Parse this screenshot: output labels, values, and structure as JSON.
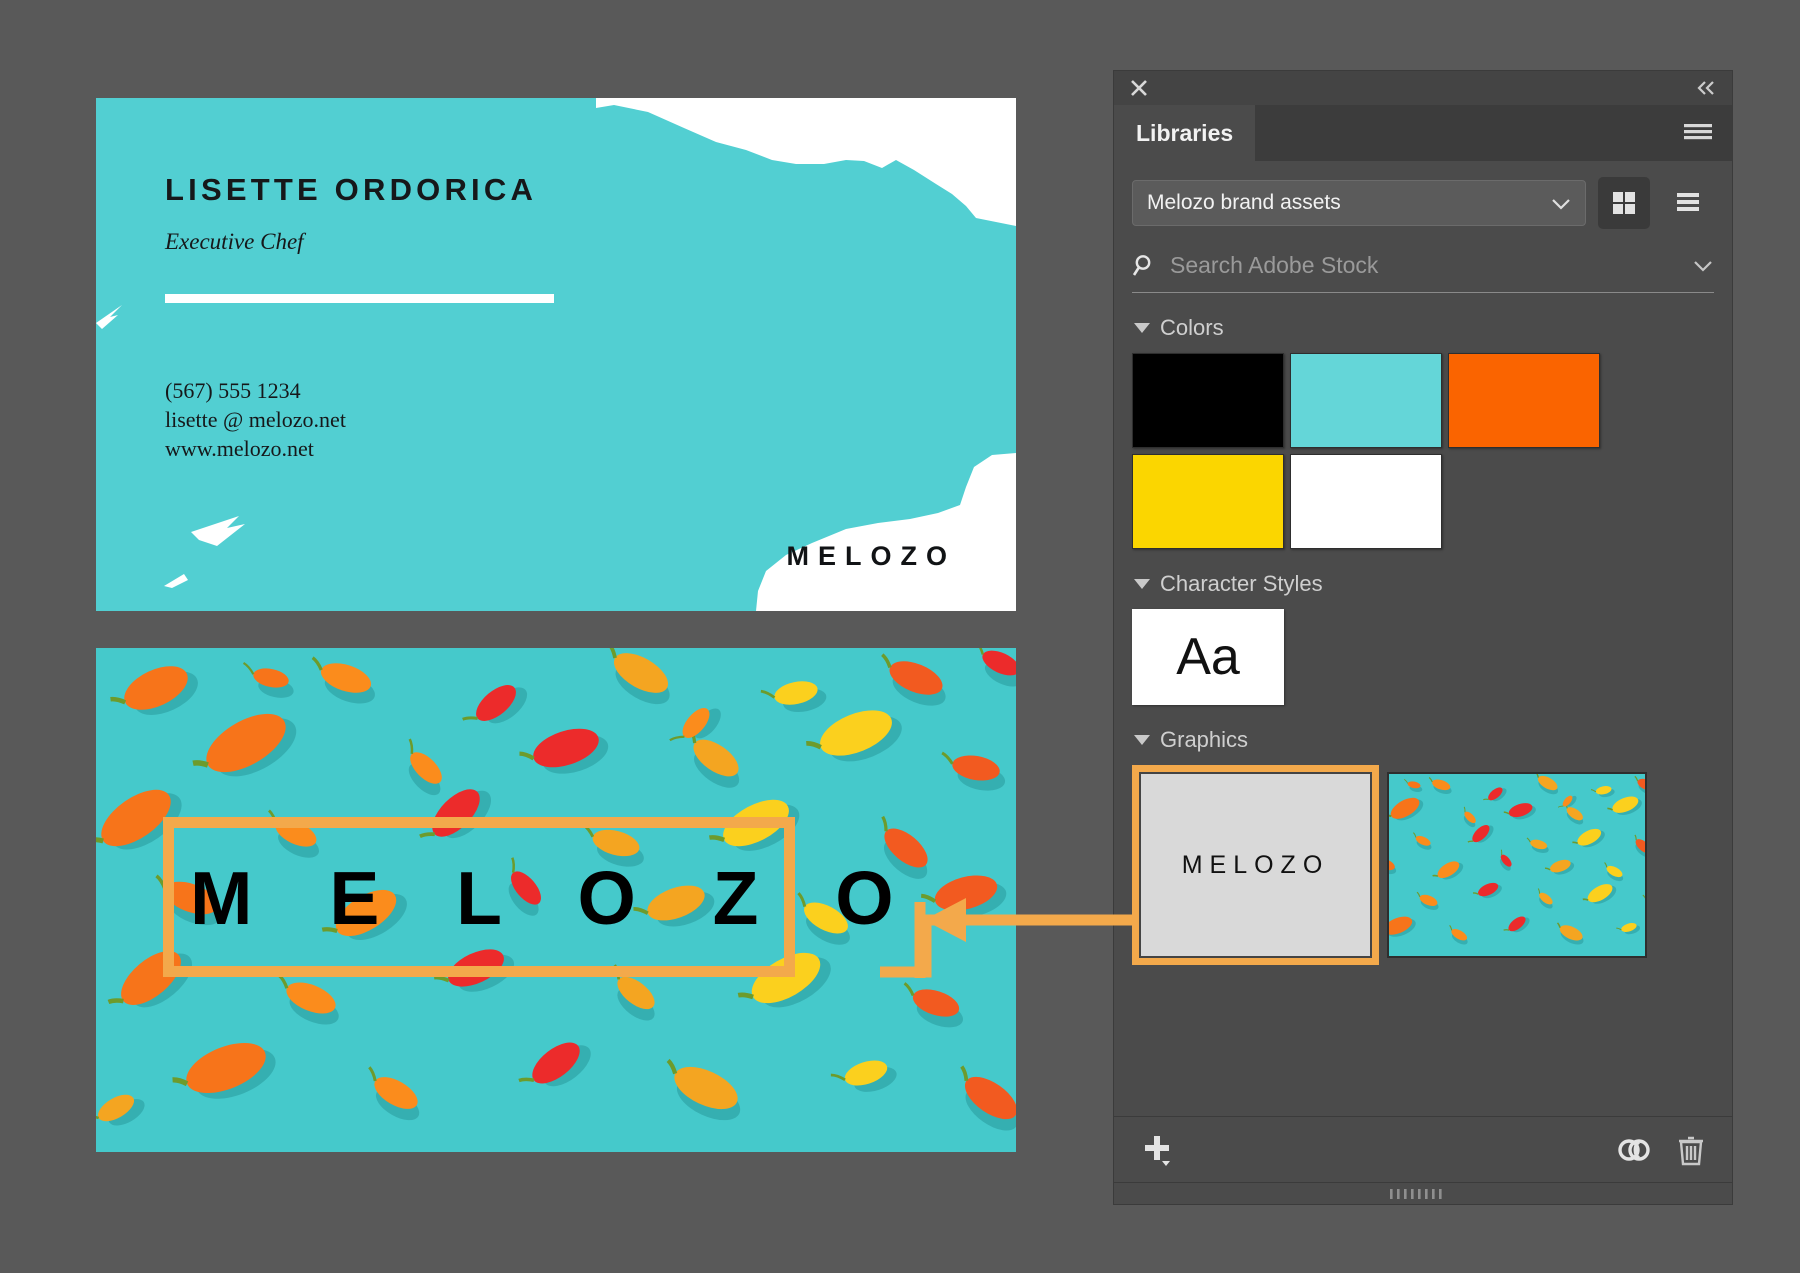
{
  "app": {
    "backdrop_color": "#595959"
  },
  "business_card": {
    "name": "LISETTE ORDORICA",
    "role": "Executive Chef",
    "phone": "(567) 555 1234",
    "email": "lisette @ melozo.net",
    "website": "www.melozo.net",
    "logo": "MELOZO",
    "background_color": "#52cfd2",
    "text_color": "#16181a"
  },
  "banner": {
    "word": "M E L O Z O",
    "background_color": "#45c9cb",
    "highlight_color": "#f3a94b",
    "word_color": "#000000"
  },
  "panel": {
    "close_icon": "close-icon",
    "collapse_icon": "collapse-double-chevron-icon",
    "menu_icon": "hamburger-menu-icon",
    "tab_label": "Libraries",
    "library_select": {
      "value": "Melozo brand assets",
      "chevron_icon": "chevron-down-icon"
    },
    "view_grid_icon": "grid-view-icon",
    "view_list_icon": "list-view-icon",
    "search": {
      "icon": "search-icon",
      "placeholder": "Search Adobe Stock",
      "value": "",
      "chevron_icon": "chevron-down-icon"
    },
    "sections": {
      "colors": {
        "label": "Colors",
        "expanded": true,
        "swatches": [
          {
            "name": "black",
            "hex": "#000000"
          },
          {
            "name": "turquoise",
            "hex": "#64d6d8"
          },
          {
            "name": "orange",
            "hex": "#fa6400"
          },
          {
            "name": "yellow",
            "hex": "#fbd600"
          },
          {
            "name": "white",
            "hex": "#ffffff"
          }
        ]
      },
      "character_styles": {
        "label": "Character Styles",
        "expanded": true,
        "items": [
          {
            "name": "type-sample",
            "sample": "Aa"
          }
        ]
      },
      "graphics": {
        "label": "Graphics",
        "expanded": true,
        "items": [
          {
            "name": "melozo-logo-graphic",
            "caption": "MELOZO",
            "selected": true
          },
          {
            "name": "peppers-photo-graphic",
            "caption": "",
            "selected": false
          }
        ]
      }
    },
    "footer": {
      "add_icon": "plus-add-icon",
      "add_dropdown_icon": "caret-down-icon",
      "sync_icon": "creative-cloud-link-icon",
      "delete_icon": "trash-icon"
    },
    "resize_grip_icon": "resize-grip-icon"
  },
  "annotation": {
    "arrow_color": "#f3a94b",
    "arrow_icon": "left-arrow-callout"
  }
}
